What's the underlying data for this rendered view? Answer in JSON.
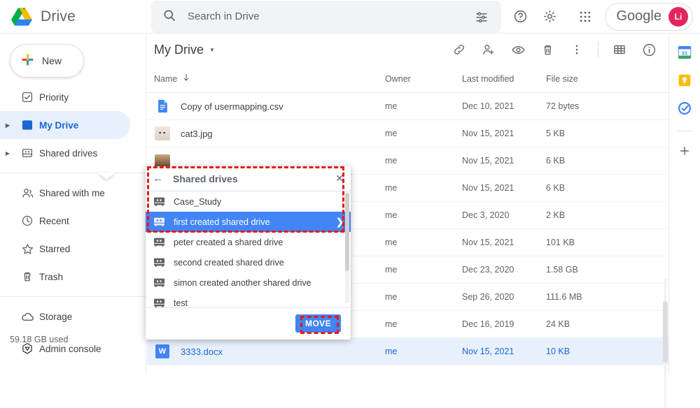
{
  "app": {
    "brand": "Drive",
    "logo_icon": "google-drive-logo"
  },
  "search": {
    "placeholder": "Search in Drive",
    "value": "",
    "search_icon": "search-icon",
    "tune_icon": "tune-options-icon"
  },
  "header_actions": {
    "help_icon": "help-circle-icon",
    "settings_icon": "gear-icon",
    "apps_icon": "apps-grid-icon",
    "account_word": "Google",
    "avatar_initials": "Li",
    "avatar_color": "#e5255e"
  },
  "sidebar": {
    "new_label": "New",
    "new_icon": "plus-colored-icon",
    "items": [
      {
        "label": "Priority",
        "icon": "priority-check-icon",
        "expandable": false,
        "active": false
      },
      {
        "label": "My Drive",
        "icon": "my-drive-icon",
        "expandable": true,
        "active": true
      },
      {
        "label": "Shared drives",
        "icon": "shared-drives-icon",
        "expandable": true,
        "active": false
      },
      {
        "label": "Shared with me",
        "icon": "people-icon",
        "expandable": false,
        "active": false
      },
      {
        "label": "Recent",
        "icon": "clock-icon",
        "expandable": false,
        "active": false
      },
      {
        "label": "Starred",
        "icon": "star-icon",
        "expandable": false,
        "active": false
      },
      {
        "label": "Trash",
        "icon": "trash-icon",
        "expandable": false,
        "active": false
      },
      {
        "label": "Storage",
        "icon": "cloud-icon",
        "expandable": false,
        "active": false
      }
    ],
    "storage_used": "59.18 GB used",
    "admin_console": "Admin console",
    "admin_icon": "admin-console-icon"
  },
  "main": {
    "breadcrumb": "My Drive",
    "breadcrumb_caret_icon": "chevron-down-icon",
    "toolbar": [
      {
        "name": "get-link-icon",
        "title": "Get link"
      },
      {
        "name": "add-person-icon",
        "title": "Share"
      },
      {
        "name": "preview-eye-icon",
        "title": "Preview"
      },
      {
        "name": "trash-icon",
        "title": "Remove"
      },
      {
        "name": "more-options-icon",
        "title": "More actions"
      },
      {
        "name": "grid-view-icon",
        "title": "Grid view"
      },
      {
        "name": "details-info-icon",
        "title": "View details"
      }
    ],
    "columns": {
      "name": "Name",
      "name_sort_icon": "arrow-down-icon",
      "owner": "Owner",
      "modified": "Last modified",
      "size": "File size"
    },
    "rows": [
      {
        "name": "Copy of usermapping.csv",
        "icon": "sheets-file-icon",
        "owner": "me",
        "modified": "Dec 10, 2021",
        "size": "72 bytes",
        "selected": false
      },
      {
        "name": "cat3.jpg",
        "icon": "cat-thumbnail",
        "owner": "me",
        "modified": "Nov 15, 2021",
        "size": "5 KB",
        "selected": false
      },
      {
        "name": "",
        "icon": "image-thumbnail",
        "owner": "me",
        "modified": "Nov 15, 2021",
        "size": "6 KB",
        "selected": false
      },
      {
        "name": "",
        "icon": "image-thumbnail",
        "owner": "me",
        "modified": "Nov 15, 2021",
        "size": "6 KB",
        "selected": false
      },
      {
        "name": "",
        "icon": "file-icon",
        "owner": "me",
        "modified": "Dec 3, 2020",
        "size": "2 KB",
        "selected": false
      },
      {
        "name": "",
        "icon": "file-icon",
        "owner": "me",
        "modified": "Nov 15, 2021",
        "size": "101 KB",
        "selected": false
      },
      {
        "name": "",
        "icon": "file-icon",
        "owner": "me",
        "modified": "Dec 23, 2020",
        "size": "1.58 GB",
        "selected": false
      },
      {
        "name": "",
        "icon": "file-icon",
        "owner": "me",
        "modified": "Sep 26, 2020",
        "size": "111.6 MB",
        "selected": false
      },
      {
        "name": "",
        "icon": "file-icon",
        "owner": "me",
        "modified": "Dec 16, 2019",
        "size": "24 KB",
        "selected": false
      },
      {
        "name": "3333.docx",
        "icon": "word-file-icon",
        "owner": "me",
        "modified": "Nov 15, 2021",
        "size": "10 KB",
        "selected": true
      }
    ]
  },
  "right_rail": {
    "items": [
      {
        "name": "google-calendar-icon",
        "label": "31"
      },
      {
        "name": "google-keep-icon",
        "label": ""
      },
      {
        "name": "google-tasks-icon",
        "label": ""
      }
    ],
    "add_label": "+",
    "add_icon": "plus-icon"
  },
  "move_dialog": {
    "title": "Shared drives",
    "back_icon": "back-arrow-icon",
    "close_icon": "close-icon",
    "drives": [
      {
        "label": "Case_Study",
        "icon": "shared-drive-icon",
        "highlighted": false,
        "has_chevron": false
      },
      {
        "label": "first created shared drive",
        "icon": "shared-drive-icon",
        "highlighted": true,
        "has_chevron": true
      },
      {
        "label": "peter created a shared drive",
        "icon": "shared-drive-icon",
        "highlighted": false,
        "has_chevron": false
      },
      {
        "label": "second created shared drive",
        "icon": "shared-drive-icon",
        "highlighted": false,
        "has_chevron": false
      },
      {
        "label": "simon created another shared drive",
        "icon": "shared-drive-icon",
        "highlighted": false,
        "has_chevron": false
      },
      {
        "label": "test",
        "icon": "shared-drive-icon",
        "highlighted": false,
        "has_chevron": false
      }
    ],
    "move_label": "MOVE",
    "chevron_icon": "chevron-right-icon"
  },
  "annotations": {
    "highlight_color": "#e8181b",
    "boxes": [
      {
        "name": "shared-drives-dialog-highlight"
      },
      {
        "name": "move-button-highlight"
      }
    ]
  }
}
